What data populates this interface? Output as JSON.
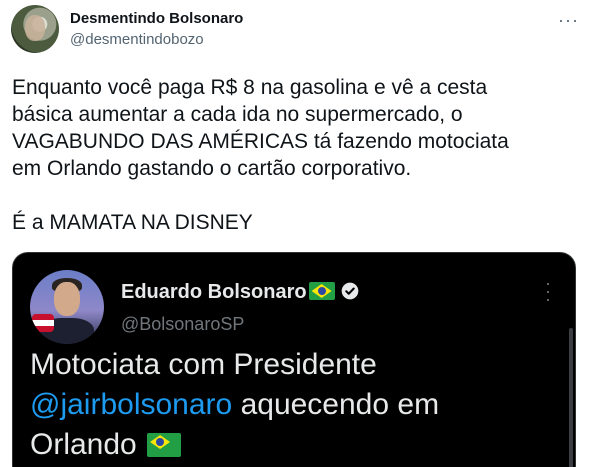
{
  "tweet": {
    "author_name": "Desmentindo Bolsonaro",
    "author_handle": "@desmentindobozo",
    "more_icon": "more-horizontal-icon",
    "text": "Enquanto você paga R$ 8 na gasolina e vê a cesta\nbásica aumentar a cada ida no supermercado, o\nVAGABUNDO DAS AMÉRICAS tá fazendo motociata\nem Orlando gastando o cartão corporativo.\n\nÉ a MAMATA NA DISNEY"
  },
  "quote": {
    "author_name": "Eduardo Bolsonaro",
    "flag_icon": "brazil-flag-icon",
    "verified_icon": "verified-badge-icon",
    "author_handle": "@BolsonaroSP",
    "more_icon": "more-vertical-icon",
    "text_before": "Motociata com Presidente",
    "mention": "@jairbolsonaro",
    "text_after": " aquecendo em",
    "text_line3": "Orlando",
    "colors": {
      "background": "#000000",
      "mention": "#1d9bf0",
      "text": "#e7e9ea",
      "handle": "#71767b"
    }
  }
}
